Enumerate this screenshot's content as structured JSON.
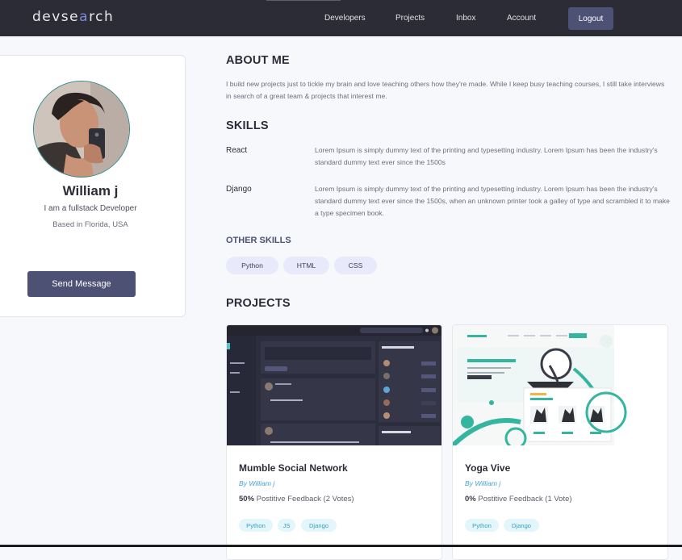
{
  "header": {
    "logo_left": "devse",
    "logo_lens": "a",
    "logo_right": "rch",
    "nav": [
      "Developers",
      "Projects",
      "Inbox",
      "Account"
    ],
    "logout": "Logout"
  },
  "profile": {
    "name": "William j",
    "tagline": "I am a fullstack Developer",
    "location": "Based in Florida, USA",
    "send_message": "Send Message"
  },
  "about": {
    "title": "ABOUT ME",
    "text": "I build new projects just to tickle my brain and love teaching others how they're made. While I keep busy teaching courses, I still take interviews in search of a great team & projects that interest me."
  },
  "skills": {
    "title": "SKILLS",
    "items": [
      {
        "name": "React",
        "desc": "Lorem Ipsum is simply dummy text of the printing and typesetting industry. Lorem Ipsum has been the industry's standard dummy text ever since the 1500s"
      },
      {
        "name": "Django",
        "desc": "Lorem Ipsum is simply dummy text of the printing and typesetting industry. Lorem Ipsum has been the industry's standard dummy text ever since the 1500s, when an unknown printer took a galley of type and scrambled it to make a type specimen book."
      }
    ],
    "other_title": "OTHER SKILLS",
    "other": [
      "Python",
      "HTML",
      "CSS"
    ]
  },
  "projects": {
    "title": "PROJECTS",
    "items": [
      {
        "title": "Mumble Social Network",
        "author": "By William j",
        "percent": "50%",
        "feedback": " Postitive Feedback (2 Votes)",
        "tags": [
          "Python",
          "JS",
          "Django"
        ]
      },
      {
        "title": "Yoga Vive",
        "author": "By William j",
        "percent": "0%",
        "feedback": " Postitive Feedback (1 Vote)",
        "tags": [
          "Python",
          "Django"
        ]
      }
    ]
  },
  "colors": {
    "header_bg": "#2b2c35",
    "accent": "#4d5173",
    "link": "#4aa3d6",
    "page_bg": "#f7f8fc"
  }
}
